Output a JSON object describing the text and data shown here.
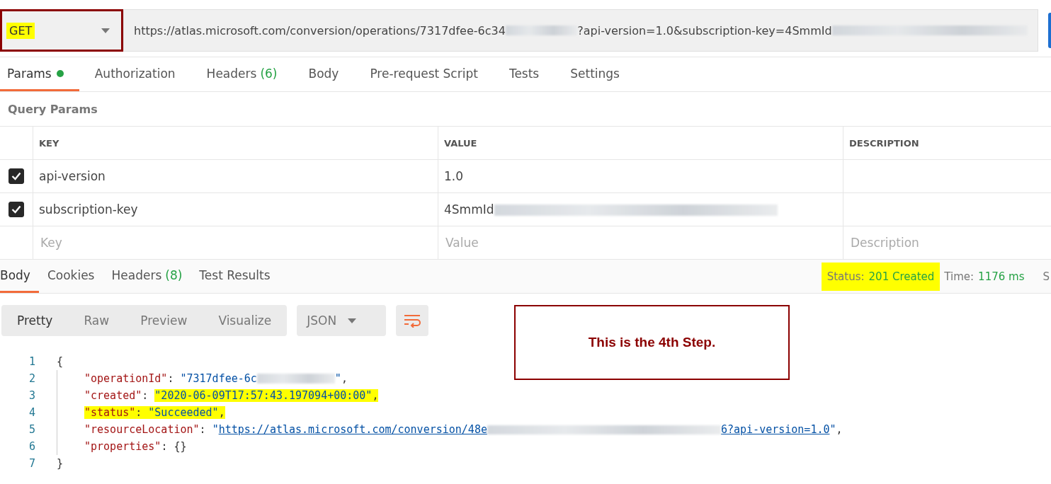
{
  "request": {
    "method": "GET",
    "method_highlighted": true,
    "url": [
      {
        "kind": "text",
        "text": "https://atlas.microsoft.com/conversion/operations/7317dfee-6c34"
      },
      {
        "kind": "redacted"
      },
      {
        "kind": "text",
        "text": "?api-version=1.0&subscription-key=4SmmId"
      },
      {
        "kind": "redacted"
      }
    ]
  },
  "request_tabs": [
    {
      "label": "Params",
      "dot": true,
      "selected": true
    },
    {
      "label": "Authorization",
      "dot": false,
      "selected": false
    },
    {
      "label": "Headers",
      "count": "(6)",
      "dot": false,
      "selected": false
    },
    {
      "label": "Body",
      "dot": false,
      "selected": false
    },
    {
      "label": "Pre-request Script",
      "dot": false,
      "selected": false
    },
    {
      "label": "Tests",
      "dot": false,
      "selected": false
    },
    {
      "label": "Settings",
      "dot": false,
      "selected": false
    }
  ],
  "query_params": {
    "title": "Query Params",
    "columns": [
      "KEY",
      "VALUE",
      "DESCRIPTION"
    ],
    "rows": [
      {
        "checked": true,
        "key": "api-version",
        "value": "1.0",
        "value_redacted": false
      },
      {
        "checked": true,
        "key": "subscription-key",
        "value": "4SmmId",
        "value_redacted": true
      }
    ],
    "new_row": [
      {
        "placeholder": "Key"
      },
      {
        "placeholder": "Value"
      },
      {
        "placeholder": "Description"
      }
    ]
  },
  "response_tabs": [
    {
      "label": "Body",
      "selected": true
    },
    {
      "label": "Cookies",
      "selected": false
    },
    {
      "label": "Headers",
      "count": "(8)",
      "selected": false
    },
    {
      "label": "Test Results",
      "selected": false
    }
  ],
  "response_meta": {
    "status_label": "Status:",
    "status": "201 Created",
    "status_highlighted": true,
    "time_label": "Time:",
    "time": "1176 ms",
    "cut_label": "S"
  },
  "view_tabs": [
    {
      "label": "Pretty",
      "selected": true
    },
    {
      "label": "Raw",
      "selected": false
    },
    {
      "label": "Preview",
      "selected": false
    },
    {
      "label": "Visualize",
      "selected": false
    }
  ],
  "format": "JSON",
  "wrap_on": true,
  "annotation": "This is the 4th Step.",
  "code": [
    {
      "number": "1",
      "tokens": [
        {
          "kind": "punct",
          "text": "{",
          "highlighted": false
        }
      ]
    },
    {
      "number": "2",
      "tokens": [
        {
          "kind": "key",
          "text": "\"operationId\"",
          "highlighted": false
        },
        {
          "kind": "punct",
          "text": ": ",
          "highlighted": false
        },
        {
          "kind": "string",
          "text": "\"7317dfee-6c",
          "highlighted": false
        },
        {
          "kind": "redacted"
        },
        {
          "kind": "string",
          "text": "\"",
          "highlighted": false
        },
        {
          "kind": "punct",
          "text": ",",
          "highlighted": false
        }
      ]
    },
    {
      "number": "3",
      "tokens": [
        {
          "kind": "key",
          "text": "\"created\"",
          "highlighted": false
        },
        {
          "kind": "punct",
          "text": ": ",
          "highlighted": false
        },
        {
          "kind": "string",
          "text": "\"2020-06-09T17:57:43.197094+00:00\"",
          "highlighted": true
        },
        {
          "kind": "punct",
          "text": ",",
          "highlighted": true
        }
      ]
    },
    {
      "number": "4",
      "tokens": [
        {
          "kind": "key",
          "text": "\"status\"",
          "highlighted": true
        },
        {
          "kind": "punct",
          "text": ": ",
          "highlighted": true
        },
        {
          "kind": "string",
          "text": "\"Succeeded\"",
          "highlighted": true
        },
        {
          "kind": "punct",
          "text": ",",
          "highlighted": true
        }
      ]
    },
    {
      "number": "5",
      "tokens": [
        {
          "kind": "key",
          "text": "\"resourceLocation\"",
          "highlighted": false
        },
        {
          "kind": "punct",
          "text": ": ",
          "highlighted": false
        },
        {
          "kind": "string",
          "text": "\"",
          "highlighted": false
        },
        {
          "kind": "link",
          "parts": [
            {
              "kind": "text",
              "text": "https://atlas.microsoft.com/conversion/48e"
            },
            {
              "kind": "redacted"
            },
            {
              "kind": "text",
              "text": "6?api-version=1.0"
            }
          ],
          "highlighted": false
        },
        {
          "kind": "string",
          "text": "\"",
          "highlighted": false
        },
        {
          "kind": "punct",
          "text": ",",
          "highlighted": false
        }
      ]
    },
    {
      "number": "6",
      "tokens": [
        {
          "kind": "key",
          "text": "\"properties\"",
          "highlighted": false
        },
        {
          "kind": "punct",
          "text": ": {}",
          "highlighted": false
        }
      ]
    },
    {
      "number": "7",
      "tokens": [
        {
          "kind": "punct",
          "text": "}",
          "highlighted": false
        }
      ]
    }
  ]
}
